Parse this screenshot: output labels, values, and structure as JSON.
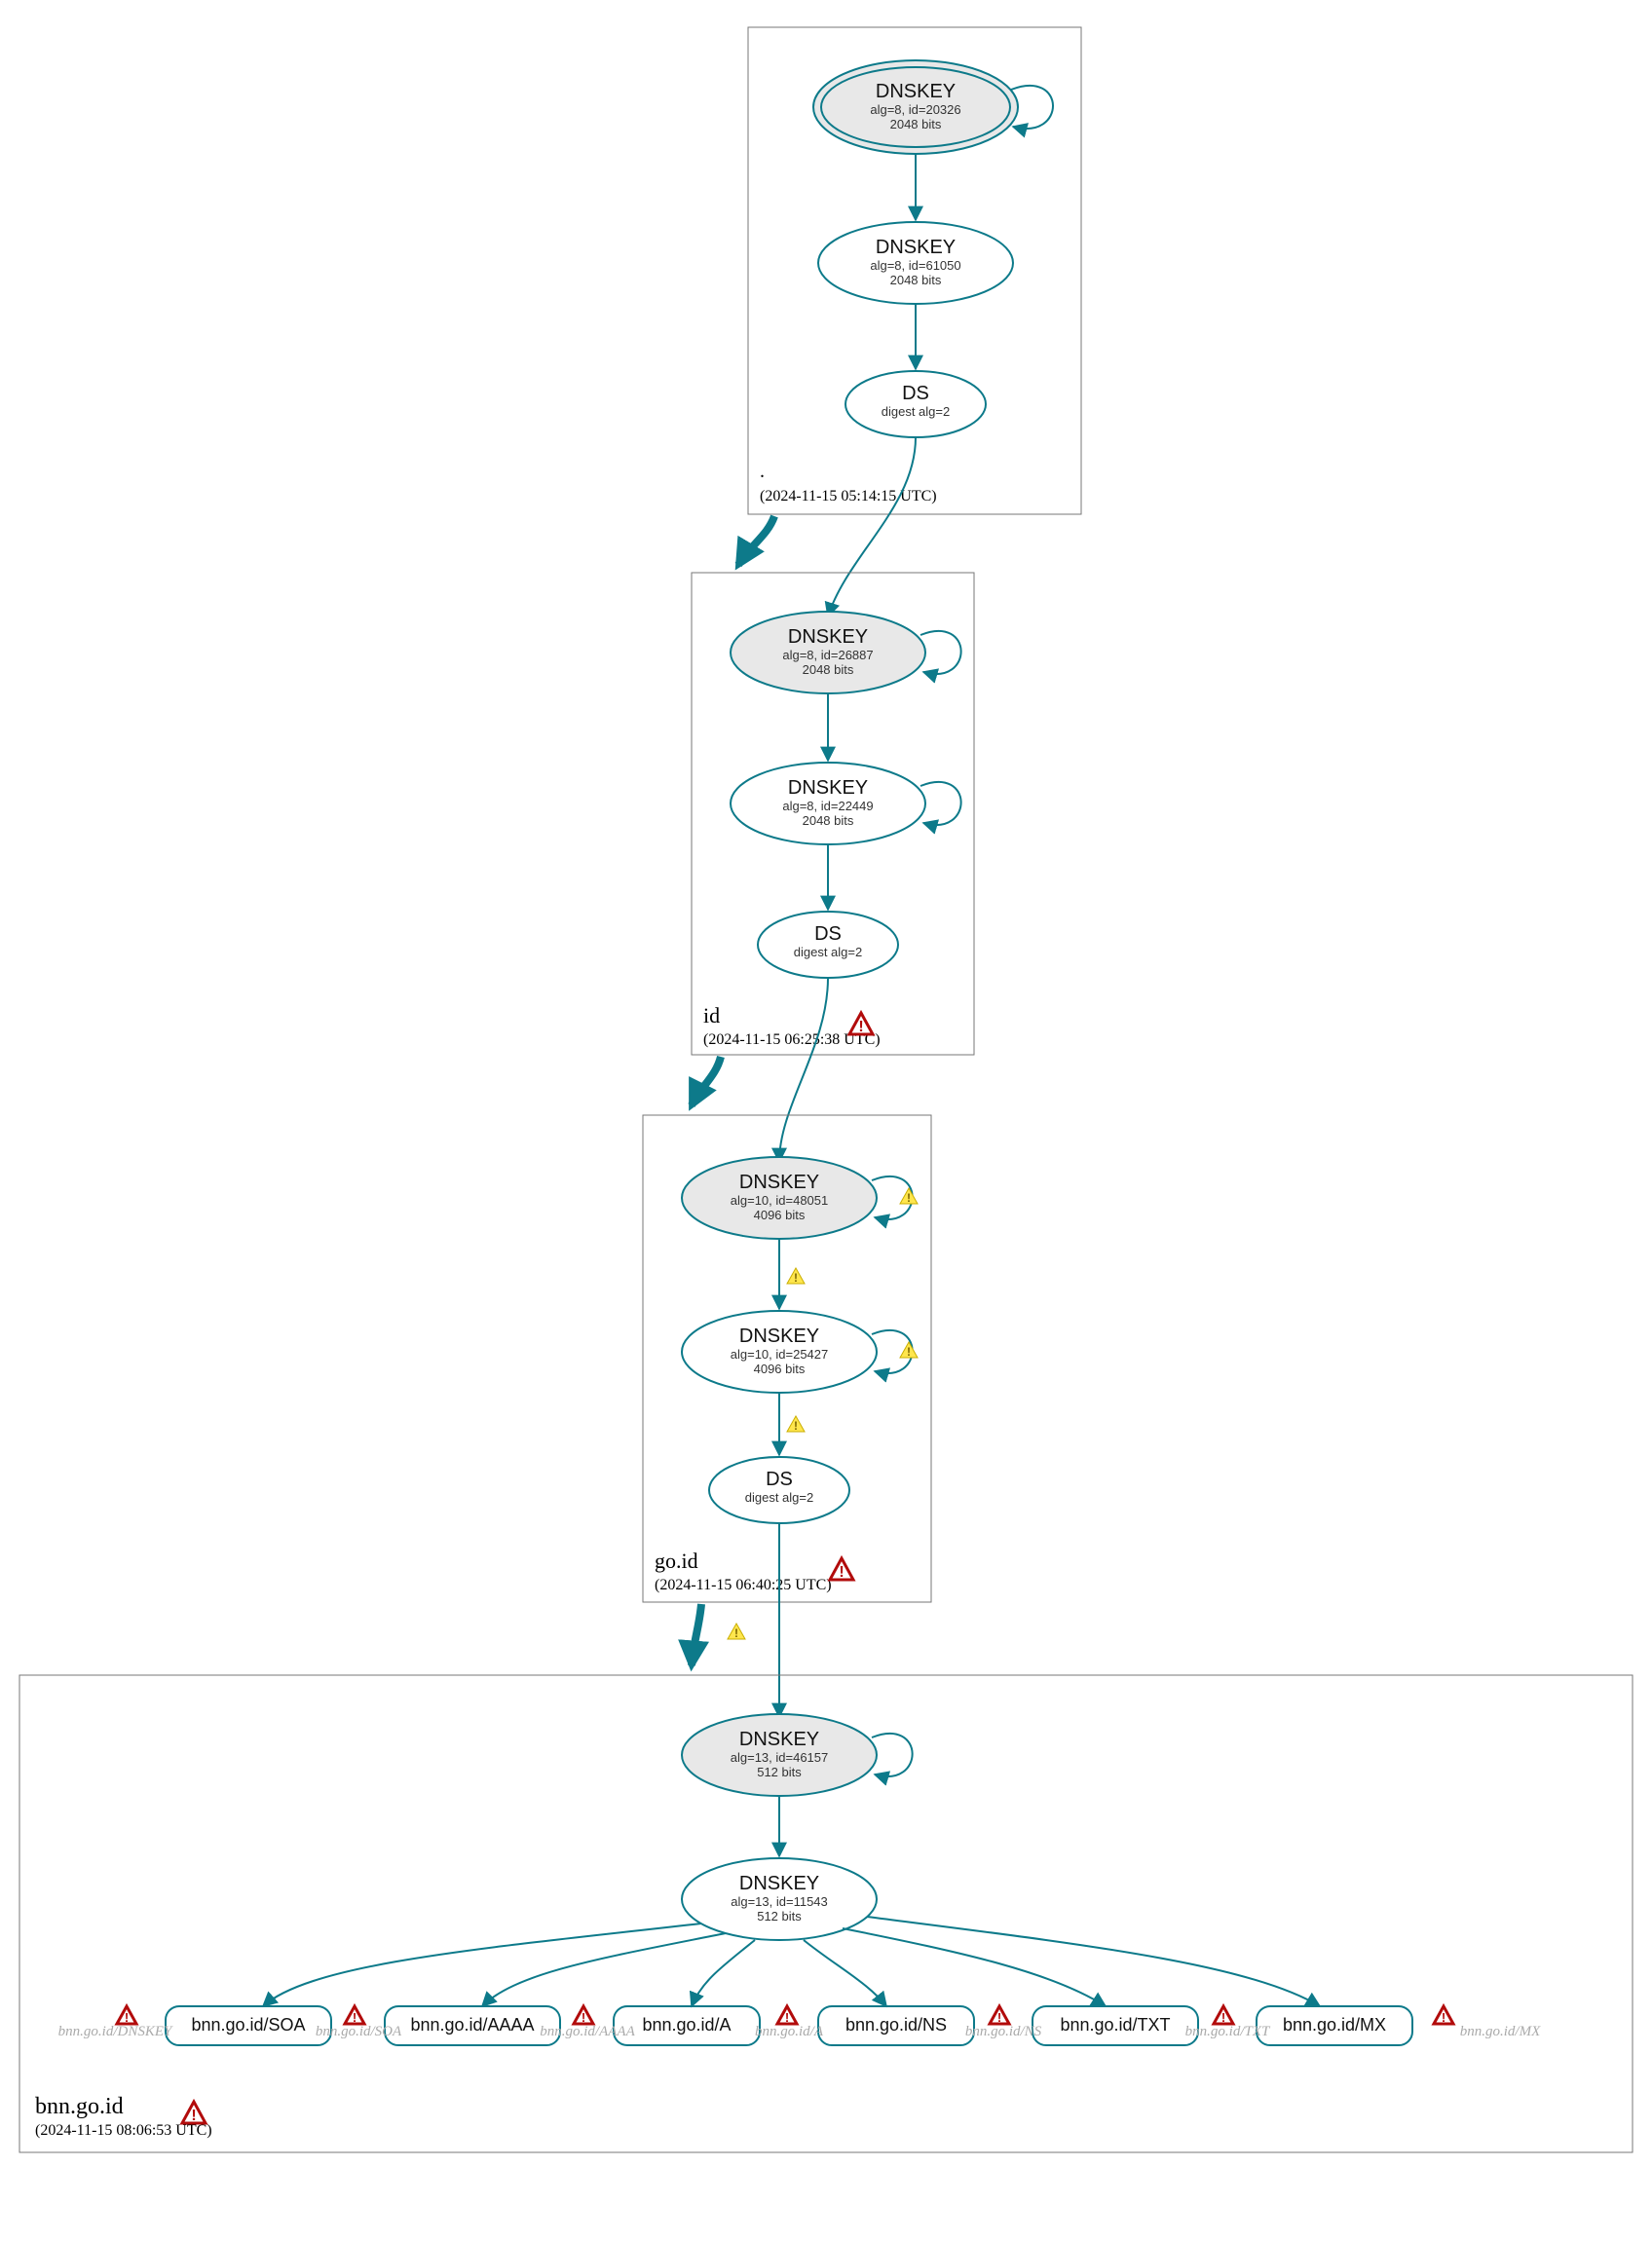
{
  "zones": {
    "root": {
      "label": ".",
      "timestamp": "(2024-11-15 05:14:15 UTC)"
    },
    "id": {
      "label": "id",
      "timestamp": "(2024-11-15 06:25:38 UTC)"
    },
    "goid": {
      "label": "go.id",
      "timestamp": "(2024-11-15 06:40:25 UTC)"
    },
    "bnn": {
      "label": "bnn.go.id",
      "timestamp": "(2024-11-15 08:06:53 UTC)"
    }
  },
  "nodes": {
    "root_ksk": {
      "t": "DNSKEY",
      "s1": "alg=8, id=20326",
      "s2": "2048 bits"
    },
    "root_zsk": {
      "t": "DNSKEY",
      "s1": "alg=8, id=61050",
      "s2": "2048 bits"
    },
    "root_ds": {
      "t": "DS",
      "s1": "digest alg=2"
    },
    "id_ksk": {
      "t": "DNSKEY",
      "s1": "alg=8, id=26887",
      "s2": "2048 bits"
    },
    "id_zsk": {
      "t": "DNSKEY",
      "s1": "alg=8, id=22449",
      "s2": "2048 bits"
    },
    "id_ds": {
      "t": "DS",
      "s1": "digest alg=2"
    },
    "goid_ksk": {
      "t": "DNSKEY",
      "s1": "alg=10, id=48051",
      "s2": "4096 bits"
    },
    "goid_zsk": {
      "t": "DNSKEY",
      "s1": "alg=10, id=25427",
      "s2": "4096 bits"
    },
    "goid_ds": {
      "t": "DS",
      "s1": "digest alg=2"
    },
    "bnn_ksk": {
      "t": "DNSKEY",
      "s1": "alg=13, id=46157",
      "s2": "512 bits"
    },
    "bnn_zsk": {
      "t": "DNSKEY",
      "s1": "alg=13, id=11543",
      "s2": "512 bits"
    }
  },
  "rrsets": {
    "soa": "bnn.go.id/SOA",
    "aaaa": "bnn.go.id/AAAA",
    "a": "bnn.go.id/A",
    "ns": "bnn.go.id/NS",
    "txt": "bnn.go.id/TXT",
    "mx": "bnn.go.id/MX"
  },
  "ghosts": {
    "dnskey": "bnn.go.id/DNSKEY",
    "soa": "bnn.go.id/SOA",
    "aaaa": "bnn.go.id/AAAA",
    "a": "bnn.go.id/A",
    "ns": "bnn.go.id/NS",
    "txt": "bnn.go.id/TXT",
    "mx": "bnn.go.id/MX"
  }
}
